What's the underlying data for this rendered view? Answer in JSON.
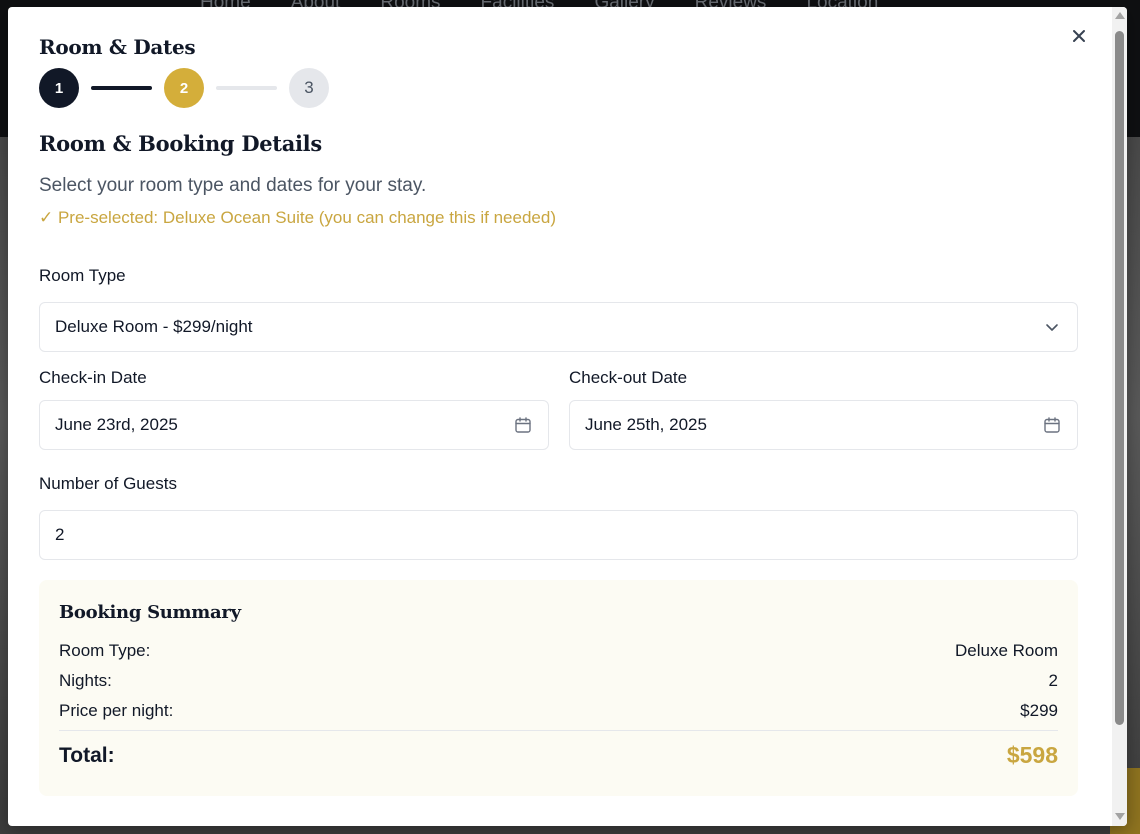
{
  "background": {
    "nav_links": [
      "Home",
      "About",
      "Rooms",
      "Facilities",
      "Gallery",
      "Reviews",
      "Location"
    ]
  },
  "modal": {
    "title": "Room & Dates",
    "close_icon": "close-icon",
    "stepper": {
      "steps": [
        "1",
        "2",
        "3"
      ],
      "current_step": 2,
      "colors": {
        "done": "#111827",
        "active": "#d4ae3a",
        "todo": "#e5e7eb"
      }
    },
    "section_title": "Room & Booking Details",
    "section_subtitle": "Select your room type and dates for your stay.",
    "preselected_note": "✓ Pre-selected: Deluxe Ocean Suite (you can change this if needed)",
    "room_type": {
      "label": "Room Type",
      "value": "Deluxe Room - $299/night",
      "icon": "chevron-down-icon"
    },
    "check_in": {
      "label": "Check-in Date",
      "value": "June 23rd, 2025",
      "icon": "calendar-icon"
    },
    "check_out": {
      "label": "Check-out Date",
      "value": "June 25th, 2025",
      "icon": "calendar-icon"
    },
    "guests": {
      "label": "Number of Guests",
      "value": "2"
    },
    "summary": {
      "title": "Booking Summary",
      "rows": [
        {
          "label": "Room Type:",
          "value": "Deluxe Room"
        },
        {
          "label": "Nights:",
          "value": "2"
        },
        {
          "label": "Price per night:",
          "value": "$299"
        }
      ],
      "total_label": "Total:",
      "total_value": "$598"
    },
    "accent_color": "#c9a640"
  }
}
